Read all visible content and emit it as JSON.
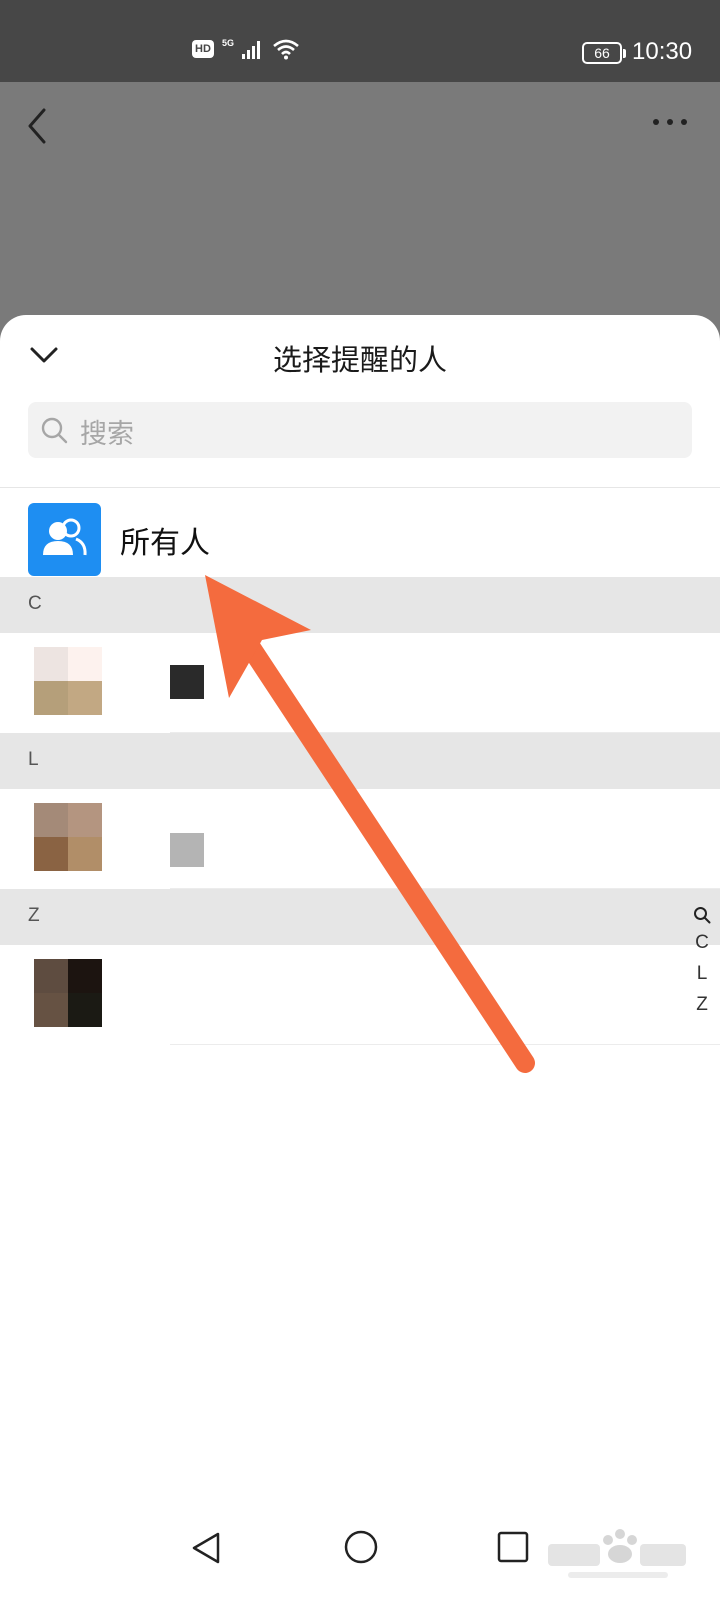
{
  "status_bar": {
    "hd_label": "HD",
    "network_label": "5G",
    "battery_level": "66",
    "time": "10:30"
  },
  "sheet": {
    "title": "选择提醒的人",
    "search_placeholder": "搜索",
    "everyone_label": "所有人"
  },
  "sections": [
    {
      "letter": "C"
    },
    {
      "letter": "L"
    },
    {
      "letter": "Z"
    }
  ],
  "index_bar": {
    "letters": [
      "C",
      "L",
      "Z"
    ]
  },
  "colors": {
    "accent_blue": "#1e8ef2",
    "annotation_arrow": "#f46b3e",
    "section_bg": "#e6e6e6"
  },
  "icons": {
    "back": "chevron-left-icon",
    "more": "more-dots-icon",
    "collapse": "chevron-down-icon",
    "search": "search-icon",
    "everyone": "group-icon",
    "nav_back": "triangle-back-icon",
    "nav_home": "circle-home-icon",
    "nav_recent": "square-recent-icon"
  }
}
